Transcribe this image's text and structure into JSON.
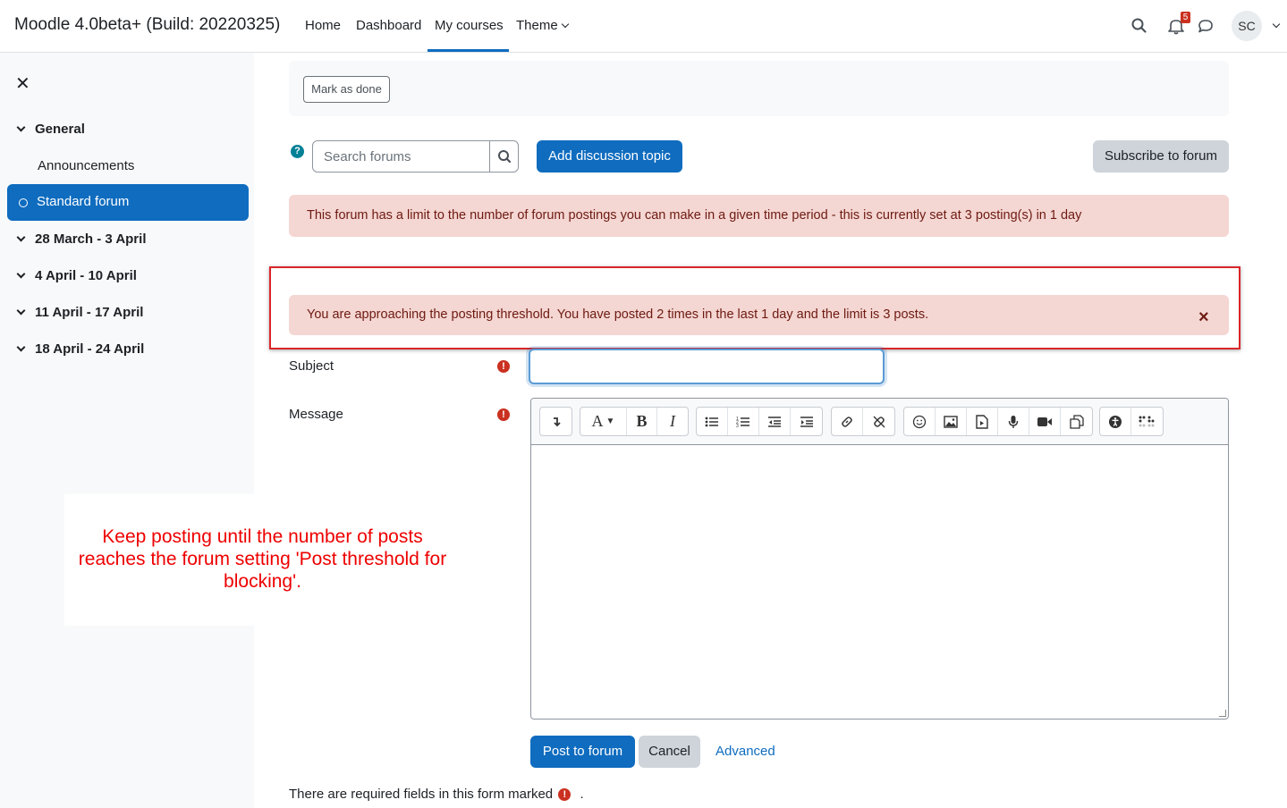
{
  "navbar": {
    "brand": "Moodle 4.0beta+ (Build: 20220325)",
    "items": [
      "Home",
      "Dashboard",
      "My courses",
      "Theme"
    ],
    "active_item": "My courses",
    "notification_count": "5",
    "avatar_initials": "SC"
  },
  "drawer": {
    "sections": [
      {
        "label": "General"
      },
      {
        "label": "28 March - 3 April"
      },
      {
        "label": "4 April - 10 April"
      },
      {
        "label": "11 April - 17 April"
      },
      {
        "label": "18 April - 24 April"
      }
    ],
    "sub_items": [
      "Announcements"
    ],
    "active_item": "Standard forum"
  },
  "main": {
    "mark_as_done": "Mark as done",
    "help_glyph": "?",
    "search_placeholder": "Search forums",
    "add_discussion": "Add discussion topic",
    "subscribe": "Subscribe to forum",
    "limit_alert": "This forum has a limit to the number of forum postings you can make in a given time period - this is currently set at 3 posting(s) in 1 day",
    "threshold_alert": "You are approaching the posting threshold. You have posted 2 times in the last 1 day and the limit is 3 posts.",
    "close_glyph": "×",
    "subject_label": "Subject",
    "message_label": "Message",
    "required_glyph": "!",
    "post_button": "Post to forum",
    "cancel_button": "Cancel",
    "advanced_link": "Advanced",
    "required_note": "There are required fields in this form marked",
    "required_note_end": "."
  },
  "annotation": {
    "text": "Keep posting until the number of posts reaches the forum setting 'Post threshold for blocking'."
  },
  "editor_toolbar": {
    "groups": [
      [
        "collapse-icon"
      ],
      [
        "font-style-icon",
        "bold-icon",
        "italic-icon"
      ],
      [
        "unordered-list-icon",
        "ordered-list-icon",
        "outdent-icon",
        "indent-icon"
      ],
      [
        "link-icon",
        "unlink-icon"
      ],
      [
        "emoji-icon",
        "image-icon",
        "media-icon",
        "record-audio-icon",
        "record-video-icon",
        "manage-files-icon"
      ],
      [
        "accessibility-checker-icon",
        "screenreader-helper-icon"
      ]
    ]
  },
  "colors": {
    "primary": "#0f6cbf",
    "alert_bg": "#f4d6d2",
    "alert_text": "#6e1a11",
    "annotation_red": "#d9262a",
    "required_red": "#ca3120"
  }
}
